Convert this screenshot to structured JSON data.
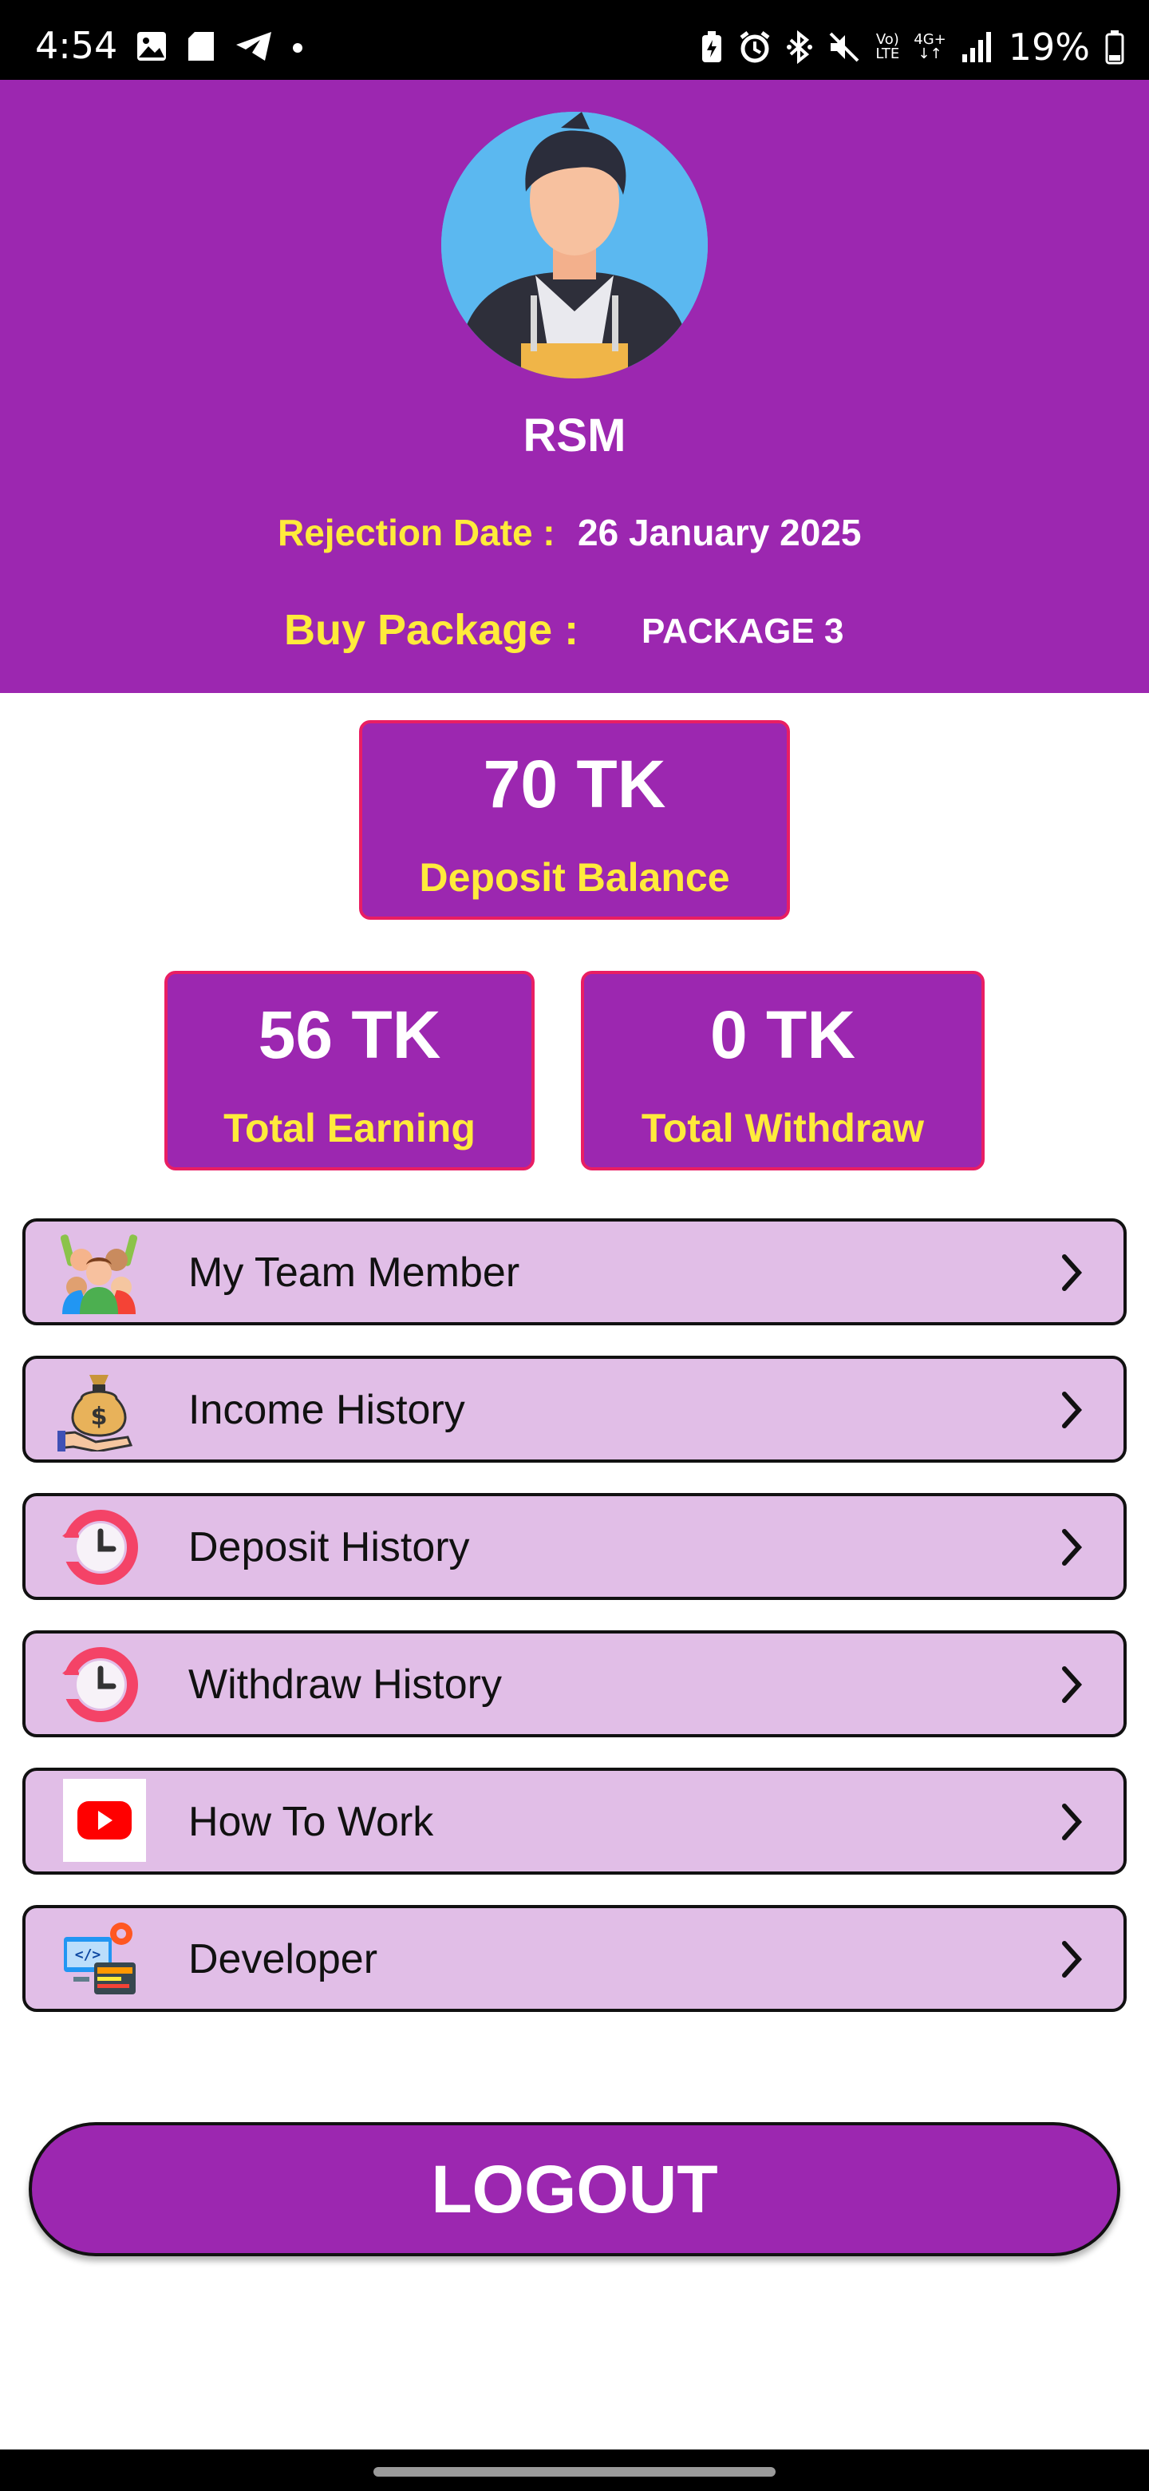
{
  "status_bar": {
    "time": "4:54",
    "battery": "19%",
    "net_top": "Vo)",
    "net_bottom": "LTE",
    "net2_top": "4G+",
    "net2_bottom": "↓↑",
    "left_icons": [
      "image-icon",
      "sd-card-icon",
      "telegram-icon",
      "dot-icon"
    ],
    "right_icons": [
      "battery-saver-icon",
      "alarm-icon",
      "bluetooth-icon",
      "mute-icon",
      "signal-icon",
      "battery-icon"
    ]
  },
  "profile": {
    "name": "RSM",
    "rejection_label": "Rejection Date :",
    "rejection_value": "26 January 2025",
    "package_label": "Buy Package :",
    "package_value": "PACKAGE 3"
  },
  "stats": {
    "deposit": {
      "amount": "70 TK",
      "caption": "Deposit Balance"
    },
    "earning": {
      "amount": "56 TK",
      "caption": "Total Earning"
    },
    "withdraw": {
      "amount": "0 TK",
      "caption": "Total Withdraw"
    }
  },
  "menu": [
    {
      "label": "My Team Member",
      "icon": "team-icon"
    },
    {
      "label": "Income History",
      "icon": "money-bag-icon"
    },
    {
      "label": "Deposit History",
      "icon": "history-clock-icon"
    },
    {
      "label": "Withdraw History",
      "icon": "history-clock-icon"
    },
    {
      "label": "How To Work",
      "icon": "youtube-icon"
    },
    {
      "label": "Developer",
      "icon": "developer-icon"
    }
  ],
  "logout_label": "LOGOUT",
  "colors": {
    "primary": "#9c27b0",
    "accent_text": "#ffeb3b",
    "card_border": "#e91e63",
    "menu_bg": "#e1bee7"
  }
}
